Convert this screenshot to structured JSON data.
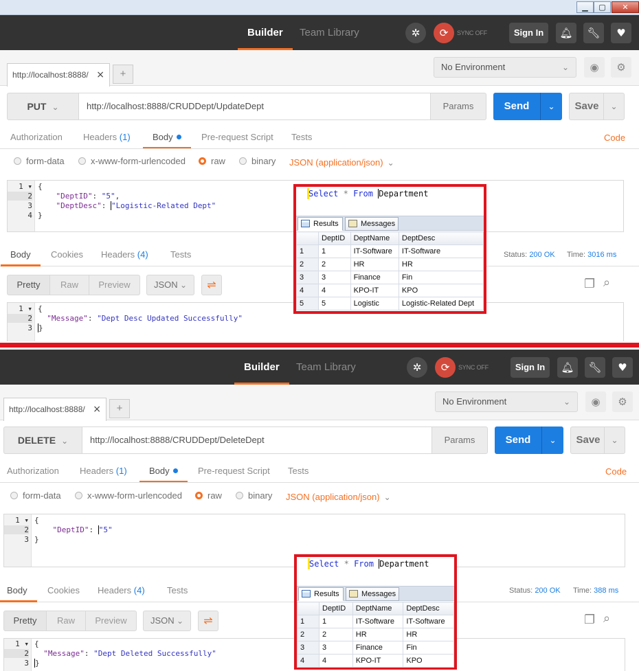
{
  "topbar": {
    "builder": "Builder",
    "team_library": "Team Library",
    "sync": "SYNC OFF",
    "sign_in": "Sign In"
  },
  "environment": "No Environment",
  "request_tabs": {
    "labels": [
      "Authorization",
      "Headers",
      "Body",
      "Pre-request Script",
      "Tests"
    ],
    "headers_count": "(1)",
    "code": "Code"
  },
  "body_modes": [
    "form-data",
    "x-www-form-urlencoded",
    "raw",
    "binary"
  ],
  "content_type": "JSON (application/json)",
  "response_tabs": {
    "labels": [
      "Body",
      "Cookies",
      "Headers",
      "Tests"
    ],
    "headers_count": "(4)"
  },
  "status_label": "Status:",
  "time_label": "Time:",
  "format": {
    "pretty": "Pretty",
    "raw": "Raw",
    "preview": "Preview",
    "json": "JSON"
  },
  "sql": {
    "query": {
      "select": "Select",
      "star": "*",
      "from": "From",
      "table": "Department"
    },
    "tabs": [
      "Results",
      "Messages"
    ],
    "columns": [
      "DeptID",
      "DeptName",
      "DeptDesc"
    ]
  },
  "panels": [
    {
      "tab_title": "http://localhost:8888/",
      "method": "PUT",
      "url": "http://localhost:8888/CRUDDept/UpdateDept",
      "params": "Params",
      "send": "Send",
      "save": "Save",
      "body_lines": [
        {
          "n": "1",
          "t": "{"
        },
        {
          "n": "2",
          "k": "\"DeptID\"",
          "sep": ": ",
          "v": "\"5\"",
          "end": ","
        },
        {
          "n": "3",
          "k": "\"DeptDesc\"",
          "sep": ": ",
          "v": "\"Logistic-Related Dept\"",
          "end": ""
        },
        {
          "n": "4",
          "t": "}"
        }
      ],
      "status": "200 OK",
      "time": "3016 ms",
      "response_lines": [
        {
          "n": "1",
          "t": "{"
        },
        {
          "n": "2",
          "k": "\"Message\"",
          "sep": ": ",
          "v": "\"Dept Desc Updated Successfully\""
        },
        {
          "n": "3",
          "t": "}"
        }
      ],
      "rows": [
        [
          "1",
          "1",
          "IT-Software",
          "IT-Software"
        ],
        [
          "2",
          "2",
          "HR",
          "HR"
        ],
        [
          "3",
          "3",
          "Finance",
          "Fin"
        ],
        [
          "4",
          "4",
          "KPO-IT",
          "KPO"
        ],
        [
          "5",
          "5",
          "Logistic",
          "Logistic-Related Dept"
        ]
      ]
    },
    {
      "tab_title": "http://localhost:8888/",
      "method": "DELETE",
      "url": "http://localhost:8888/CRUDDept/DeleteDept",
      "params": "Params",
      "send": "Send",
      "save": "Save",
      "body_lines": [
        {
          "n": "1",
          "t": "{"
        },
        {
          "n": "2",
          "k": "\"DeptID\"",
          "sep": ": ",
          "v": "\"5\"",
          "end": ""
        },
        {
          "n": "3",
          "t": "}"
        }
      ],
      "status": "200 OK",
      "time": "388 ms",
      "response_lines": [
        {
          "n": "1",
          "t": "{"
        },
        {
          "n": "2",
          "k": "\"Message\"",
          "sep": ": ",
          "v": "\"Dept Deleted Successfully\""
        },
        {
          "n": "3",
          "t": "}"
        }
      ],
      "rows": [
        [
          "1",
          "1",
          "IT-Software",
          "IT-Software"
        ],
        [
          "2",
          "2",
          "HR",
          "HR"
        ],
        [
          "3",
          "3",
          "Finance",
          "Fin"
        ],
        [
          "4",
          "4",
          "KPO-IT",
          "KPO"
        ]
      ]
    }
  ]
}
